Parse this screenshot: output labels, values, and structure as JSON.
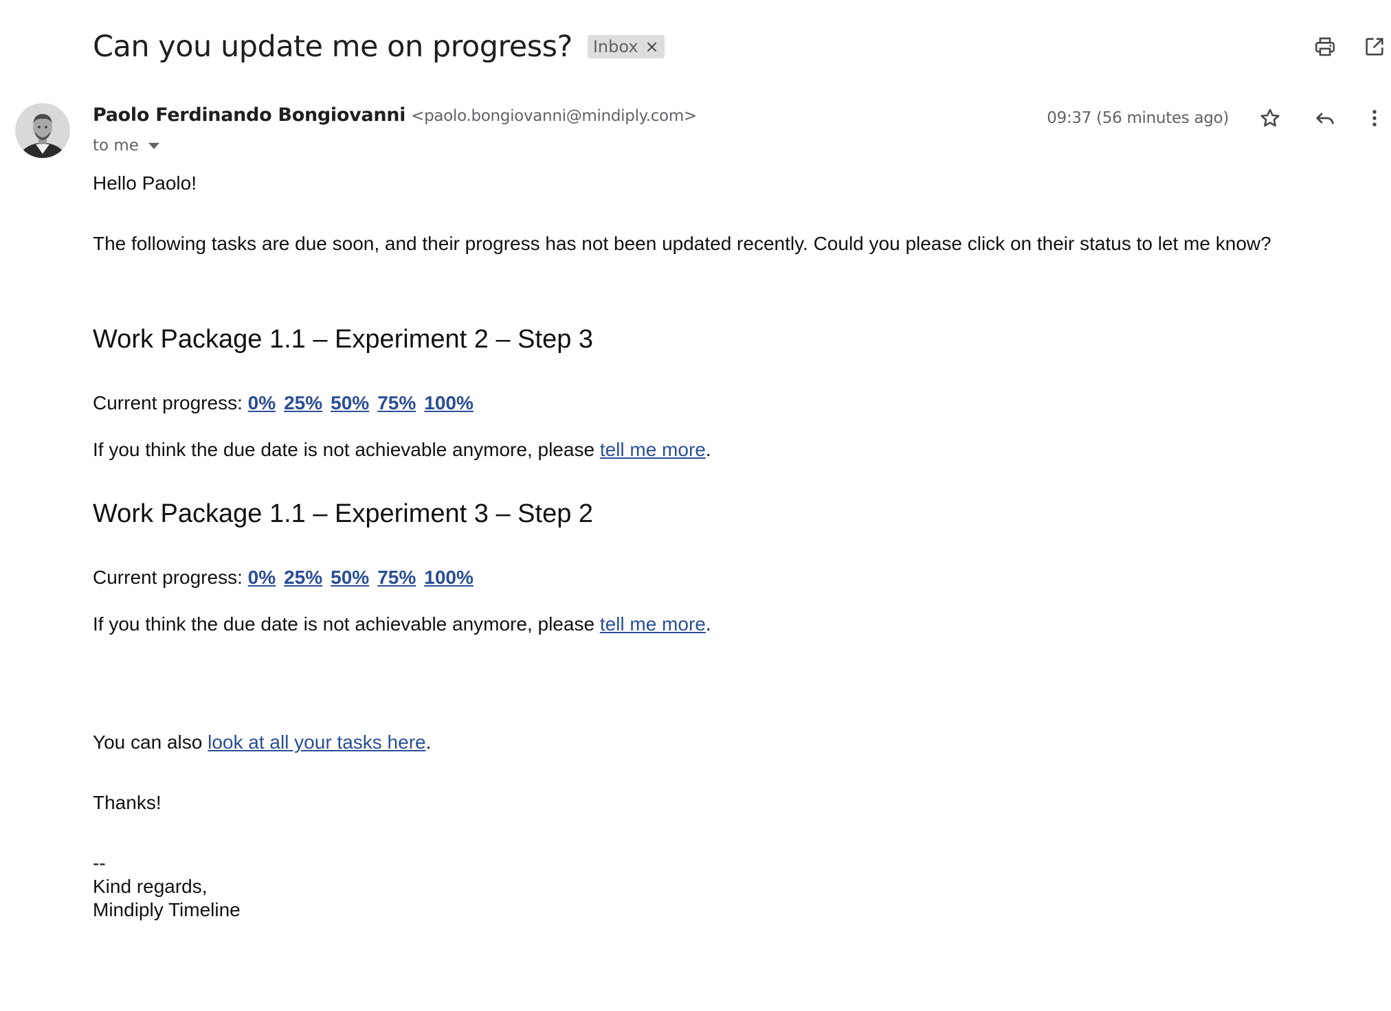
{
  "email": {
    "subject": "Can you update me on progress?",
    "label": "Inbox",
    "label_remove": "×",
    "sender": {
      "name": "Paolo Ferdinando Bongiovanni",
      "email": "<paolo.bongiovanni@mindiply.com>"
    },
    "recipient": "to me",
    "timestamp": "09:37 (56 minutes ago)",
    "icons": {
      "print": "print-icon",
      "open_new_window": "open-in-new-icon",
      "star": "star-outline-icon",
      "reply": "reply-icon",
      "more": "more-vert-icon",
      "caret": "caret-down-icon"
    }
  },
  "body": {
    "greeting": "Hello Paolo!",
    "intro": "The following tasks are due soon, and their progress has not been updated recently. Could you please click on their status to let me know?",
    "tasks": [
      {
        "title": "Work Package 1.1 – Experiment 2 – Step 3",
        "progress_prefix": "Current progress: ",
        "progress_options": [
          "0%",
          "25%",
          "50%",
          "75%",
          "100%"
        ],
        "due_text": "If you think the due date is not achievable anymore, please ",
        "due_link": "tell me more",
        "due_suffix": "."
      },
      {
        "title": "Work Package 1.1 – Experiment 3 – Step 2",
        "progress_prefix": "Current progress: ",
        "progress_options": [
          "0%",
          "25%",
          "50%",
          "75%",
          "100%"
        ],
        "due_text": "If you think the due date is not achievable anymore, please ",
        "due_link": "tell me more",
        "due_suffix": "."
      }
    ],
    "all_tasks_prefix": "You can also ",
    "all_tasks_link": "look at all your tasks here",
    "all_tasks_suffix": ".",
    "thanks": "Thanks!",
    "signature": {
      "separator": "--",
      "closing": "Kind regards,",
      "name": "Mindiply Timeline"
    }
  },
  "colors": {
    "link": "#2a4e96",
    "text": "#111111",
    "muted": "#5f6368",
    "chip_bg": "#dddddd"
  }
}
